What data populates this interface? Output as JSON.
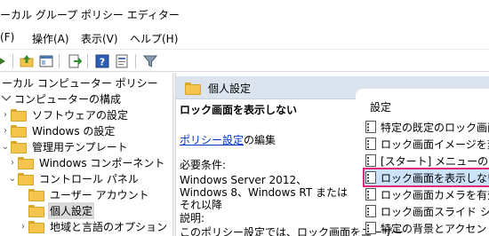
{
  "window": {
    "title": "ーカル グループ ポリシー エディター"
  },
  "menu": {
    "items": [
      {
        "label": "(F)"
      },
      {
        "label": "操作(A)"
      },
      {
        "label": "表示(V)"
      },
      {
        "label": "ヘルプ(H)"
      }
    ]
  },
  "tree": {
    "items": [
      {
        "label": "ーカル コンピューター ポリシー"
      },
      {
        "label": "コンピューターの構成"
      },
      {
        "label": "ソフトウェアの設定"
      },
      {
        "label": "Windows の設定"
      },
      {
        "label": "管理用テンプレート"
      },
      {
        "label": "Windows コンポーネント"
      },
      {
        "label": "コントロール パネル"
      },
      {
        "label": "ユーザー アカウント"
      },
      {
        "label": "個人設定"
      },
      {
        "label": "地域と言語のオプション"
      }
    ]
  },
  "detail": {
    "header": "個人設定",
    "policy_title": "ロック画面を表示しない",
    "edit_link": "ポリシー設定",
    "edit_suffix": "の編集",
    "requirements_label": "必要条件:",
    "requirements_text": "Windows Server 2012、Windows 8、Windows RT またはそれ以降",
    "explanation_label": "説明:",
    "explanation_text": "このポリシー設定では、ロック画面をユーザー"
  },
  "settings": {
    "column_header": "設定",
    "items": [
      {
        "label": "特定の既定のロック画面"
      },
      {
        "label": "ロック画面イメージを変更"
      },
      {
        "label": "[スタート] メニューの背景を"
      },
      {
        "label": "ロック画面を表示しない"
      },
      {
        "label": "ロック画面カメラを有効に"
      },
      {
        "label": "ロック画面スライド ショーを"
      },
      {
        "label": "特定の背景とアクセント"
      }
    ]
  },
  "colors": {
    "header_band": "#dbe4ee",
    "selection_outline": "#e2267c",
    "selection_fill": "#cce3f9",
    "link": "#0033cc"
  }
}
